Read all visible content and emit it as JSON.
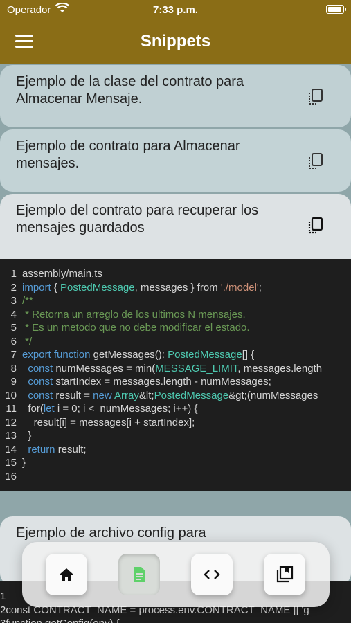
{
  "status": {
    "carrier": "Operador",
    "time": "7:33 p.m."
  },
  "appbar": {
    "title": "Snippets",
    "menu_icon": "menu-icon"
  },
  "snippets": [
    {
      "title": "Ejemplo de la clase del contrato para Almacenar Mensaje."
    },
    {
      "title": "Ejemplo de contrato para Almacenar mensajes."
    },
    {
      "title": "Ejemplo del contrato para recuperar los mensajes guardados"
    },
    {
      "title": "Ejemplo de archivo config para"
    }
  ],
  "code_lines": [
    "assembly/main.ts",
    "import { PostedMessage, messages } from './model';",
    "/**",
    " * Retorna un arreglo de los ultimos N mensajes.",
    " * Es un metodo que no debe modificar el estado.",
    " */",
    "export function getMessages(): PostedMessage[] {",
    "  const numMessages = min(MESSAGE_LIMIT, messages.length",
    "  const startIndex = messages.length - numMessages;",
    "  const result = new Array&lt;PostedMessage&gt;(numMessages",
    "  for(let i = 0; i <  numMessages; i++) {",
    "    result[i] = messages[i + startIndex];",
    "  }",
    "  return result;",
    "}",
    ""
  ],
  "code2_lines": [
    "",
    "const CONTRACT_NAME = process.env.CONTRACT_NAME || 'g",
    "function getConfig(env) {"
  ],
  "nav": {
    "items": [
      {
        "icon": "home-icon"
      },
      {
        "icon": "document-icon",
        "active": true
      },
      {
        "icon": "code-icon"
      },
      {
        "icon": "bookmarks-icon"
      }
    ]
  },
  "colors": {
    "appbar": "#8a6d16",
    "code_bg": "#1e1e1e",
    "keyword": "#569cd6",
    "type": "#4ec9b0",
    "string": "#ce9178",
    "comment": "#6a9955",
    "active_icon": "#5fd16a"
  }
}
